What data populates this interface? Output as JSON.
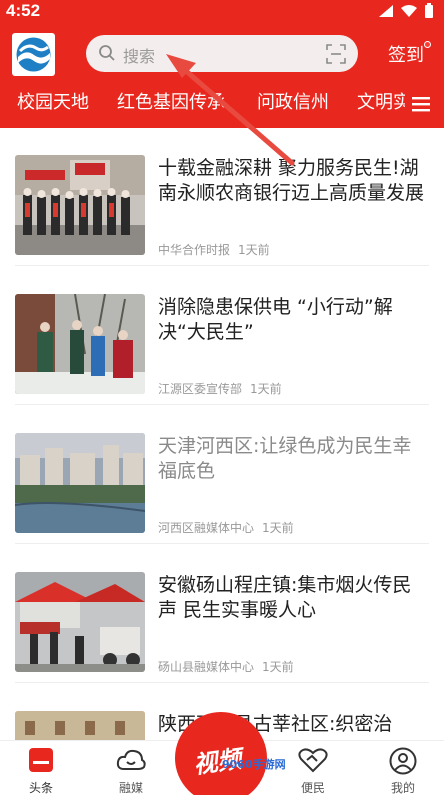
{
  "status_bar": {
    "time": "4:52"
  },
  "header": {
    "search_placeholder": "搜索",
    "signin_label": "签到"
  },
  "tabs": [
    "校园天地",
    "红色基因传承",
    "问政信州",
    "文明实践"
  ],
  "articles": [
    {
      "title": "十载金融深耕 聚力服务民生!湖南永顺农商银行迈上高质量发展",
      "source": "中华合作时报",
      "time": "1天前",
      "read": false
    },
    {
      "title": "消除隐患保供电 “小行动”解决“大民生”",
      "source": "江源区委宣传部",
      "time": "1天前",
      "read": false
    },
    {
      "title": "天津河西区:让绿色成为民生幸福底色",
      "source": "河西区融媒体中心",
      "time": "1天前",
      "read": true
    },
    {
      "title": "安徽砀山程庄镇:集市烟火传民声 民生实事暖人心",
      "source": "砀山县融媒体中心",
      "time": "1天前",
      "read": false
    },
    {
      "title": "陕西西安县古莘社区:织密治",
      "source": "",
      "time": "",
      "read": false
    }
  ],
  "bottom_nav": {
    "home": "头条",
    "media": "融媒",
    "video": "视频",
    "service": "便民",
    "mine": "我的"
  },
  "watermark": "9060手游网",
  "colors": {
    "brand_red": "#e8281f",
    "search_bg": "#f4eded"
  }
}
